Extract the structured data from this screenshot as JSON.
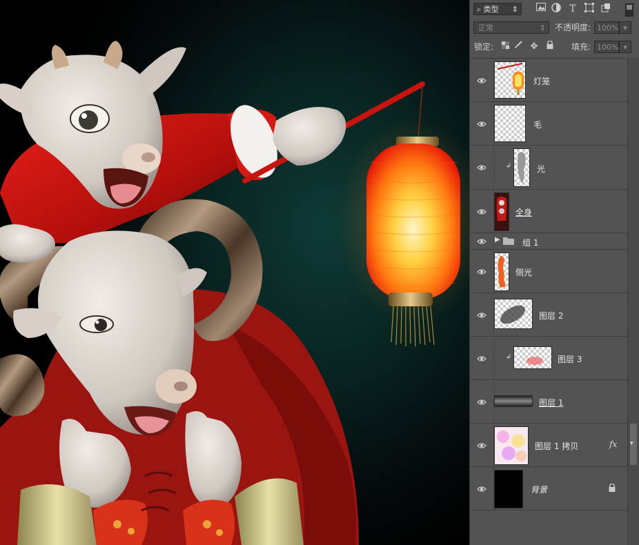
{
  "filter_bar": {
    "kind_label": "类型",
    "icons": [
      "image-filter-icon",
      "adjustment-filter-icon",
      "text-filter-icon",
      "shape-filter-icon",
      "smart-object-filter-icon"
    ]
  },
  "blend": {
    "mode": "正常",
    "opacity_label": "不透明度:",
    "opacity_value": "100%"
  },
  "lock": {
    "label": "锁定:",
    "fill_label": "填充:",
    "fill_value": "100%"
  },
  "layers": [
    {
      "name": "灯笼",
      "style": "normal",
      "thumb": "lantern"
    },
    {
      "name": "毛",
      "style": "normal",
      "thumb": "empty"
    },
    {
      "name": "光",
      "style": "normal",
      "thumb": "figure-gray",
      "clipped": true
    },
    {
      "name": "全身",
      "style": "underline",
      "thumb": "figure-red"
    },
    {
      "name": "组 1",
      "style": "group"
    },
    {
      "name": "侧光",
      "style": "normal",
      "thumb": "figure-orange"
    },
    {
      "name": "图层 2",
      "style": "normal",
      "thumb": "dark-blob"
    },
    {
      "name": "图层 3",
      "style": "normal",
      "thumb": "red-dot",
      "clipped": true
    },
    {
      "name": "图层 1",
      "style": "underline",
      "thumb": "gradient-bar"
    },
    {
      "name": "图层 1 拷贝",
      "style": "normal",
      "thumb": "pastel",
      "fx": "fx"
    },
    {
      "name": "背景",
      "style": "italic",
      "thumb": "black",
      "locked": true
    }
  ]
}
